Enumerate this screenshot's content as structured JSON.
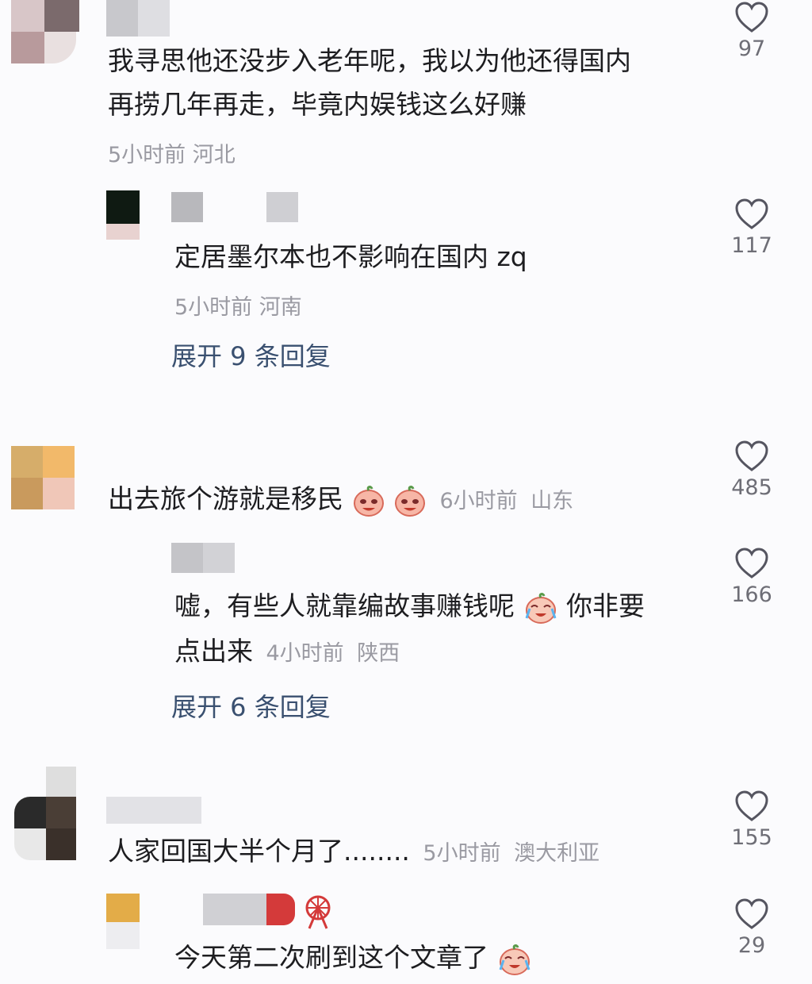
{
  "comments": [
    {
      "text_line1": "我寻思他还没步入老年呢，我以为他还得国内",
      "text_line2": "再捞几年再走，毕竟内娱钱这么好赚",
      "time": "5小时前",
      "location": "河北",
      "likes": "97",
      "reply": {
        "text": "定居墨尔本也不影响在国内 zq",
        "time": "5小时前",
        "location": "河南",
        "likes": "117"
      },
      "expand": "展开 9 条回复"
    },
    {
      "text": "出去旅个游就是移民",
      "time": "6小时前",
      "location": "山东",
      "likes": "485",
      "reply": {
        "text_line1_a": "嘘，有些人就靠编故事赚钱呢",
        "text_line1_b": "你非要",
        "text_line2": "点出来",
        "time": "4小时前",
        "location": "陕西",
        "likes": "166"
      },
      "expand": "展开 6 条回复"
    },
    {
      "text": "人家回国大半个月了........",
      "time": "5小时前",
      "location": "澳大利亚",
      "likes": "155",
      "reply": {
        "text": "今天第二次刷到这个文章了",
        "likes": "29"
      }
    }
  ],
  "icons": {
    "like": "heart-outline-icon",
    "emoji_laugh": "peach-laugh-emoji",
    "emoji_cry": "cry-laugh-emoji",
    "badge": "ferris-wheel-icon"
  },
  "colors": {
    "text": "#1d1d20",
    "meta": "#9a9aa2",
    "expand": "#3a5070",
    "heart": "#555560"
  }
}
